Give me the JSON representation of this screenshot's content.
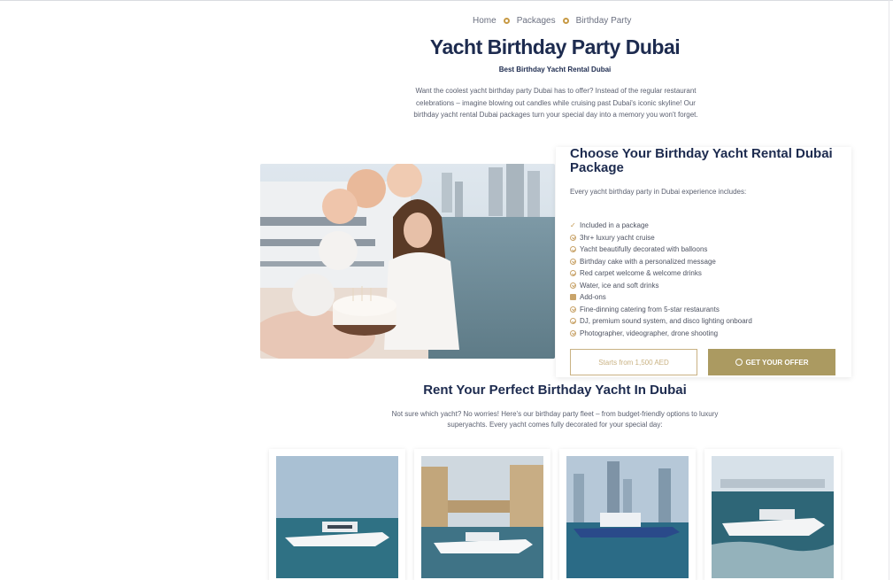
{
  "breadcrumb": {
    "items": [
      "Home",
      "Packages",
      "Birthday Party"
    ]
  },
  "header": {
    "title": "Yacht Birthday Party Dubai",
    "subtitle": "Best Birthday Yacht Rental Dubai",
    "intro": "Want the coolest yacht birthday party Dubai has to offer? Instead of the regular restaurant celebrations – imagine blowing out candles while cruising past Dubai's iconic skyline! Our birthday yacht rental Dubai packages turn your special day into a memory you won't forget."
  },
  "package": {
    "title": "Choose Your Birthday Yacht Rental Dubai Package",
    "lead": "Every yacht birthday party in Dubai experience includes:",
    "items": [
      {
        "label": "Included in a package",
        "icon": "tick-icon"
      },
      {
        "label": "3hr+ luxury yacht cruise",
        "icon": "check-circle-icon"
      },
      {
        "label": "Yacht beautifully decorated with balloons",
        "icon": "check-circle-icon"
      },
      {
        "label": "Birthday cake with a personalized message",
        "icon": "check-circle-icon"
      },
      {
        "label": "Red carpet welcome & welcome drinks",
        "icon": "check-circle-icon"
      },
      {
        "label": "Water, ice and soft drinks",
        "icon": "check-circle-icon"
      },
      {
        "label": "Add-ons",
        "icon": "plus-icon"
      },
      {
        "label": "Fine-dinning catering from 5-star restaurants",
        "icon": "check-circle-icon"
      },
      {
        "label": "DJ, premium sound system, and disco lighting onboard",
        "icon": "check-circle-icon"
      },
      {
        "label": "Photographer, videographer, drone shooting",
        "icon": "check-circle-icon"
      }
    ],
    "price_label": "Starts from 1,500 AED",
    "offer_label": "GET YOUR OFFER"
  },
  "fleet": {
    "title": "Rent Your Perfect Birthday Yacht In Dubai",
    "description": "Not sure which yacht? No worries! Here's our birthday party fleet – from budget-friendly options to luxury superyachts. Every yacht comes fully decorated for your special day:"
  },
  "colors": {
    "navy": "#1d2b4f",
    "gold": "#ab9a61",
    "gold_light": "#c9b283",
    "text": "#5b6070"
  }
}
